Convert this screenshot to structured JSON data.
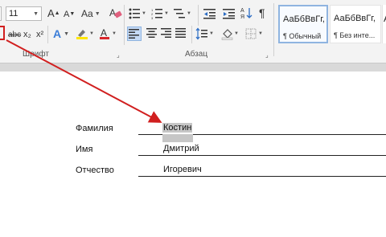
{
  "ribbon": {
    "font_size_value": "11",
    "grow_font_label": "A",
    "shrink_font_label": "A",
    "change_case_label": "Aa",
    "pilcrow_label": "¶",
    "strike_label": "abc",
    "subscript_label": "x₂",
    "superscript_label": "x²",
    "text_effects_label": "A",
    "font_color_label": "A",
    "group_font_label": "Шрифт",
    "group_paragraph_label": "Абзац",
    "styles": [
      {
        "sample": "АаБбВвГг,",
        "name": "¶ Обычный"
      },
      {
        "sample": "АаБбВвГг,",
        "name": "¶ Без инте..."
      },
      {
        "sample": "А",
        "name": ""
      }
    ],
    "colors": {
      "highlight": "#ffe600",
      "font_color": "#d9262b",
      "arrow": "#d11f1f"
    }
  },
  "document": {
    "fields": [
      {
        "label": "Фамилия",
        "value": "Костин",
        "selected": true
      },
      {
        "label": "Имя",
        "value": "Дмитрий",
        "selected": false
      },
      {
        "label": "Отчество",
        "value": "Игоревич",
        "selected": false
      }
    ],
    "selection_color": "#c6c6c6"
  }
}
